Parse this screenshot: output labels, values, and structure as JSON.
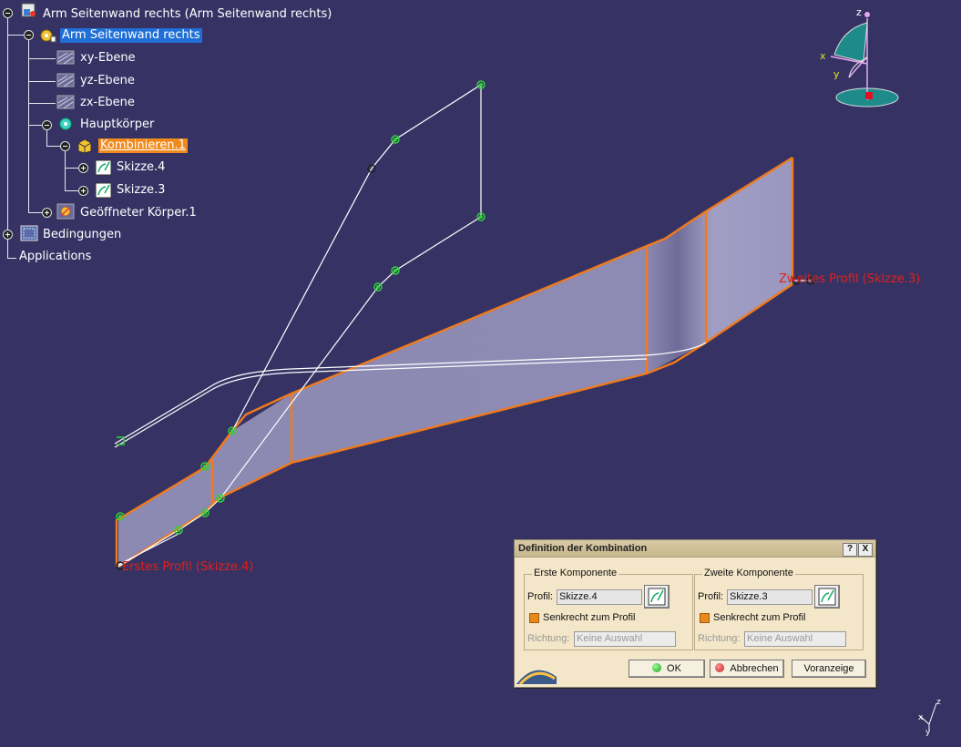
{
  "tree": {
    "root": "Arm Seitenwand rechts (Arm Seitenwand rechts)",
    "part": "Arm Seitenwand rechts",
    "xy": "xy-Ebene",
    "yz": "yz-Ebene",
    "zx": "zx-Ebene",
    "body": "Hauptkörper",
    "combine": "Kombinieren.1",
    "sketch4": "Skizze.4",
    "sketch3": "Skizze.3",
    "openbody": "Geöffneter Körper.1",
    "constraints": "Bedingungen",
    "applications": "Applications"
  },
  "viewport": {
    "second_profile_label": "Zweites Profil (Skizze.3)",
    "first_profile_label": "Erstes Profil (Skizze.4)",
    "compass_z": "z",
    "compass_x": "x",
    "compass_y": "y",
    "axis_z": "z",
    "axis_x": "x",
    "axis_y": "y",
    "colors": {
      "edge": "#f07a1c",
      "surface": "#9390b8",
      "wire": "#ffffff",
      "point": "#2fd13a",
      "background": "#363364"
    }
  },
  "dialog": {
    "title": "Definition der Kombination",
    "help": "?",
    "close": "X",
    "first": {
      "group": "Erste Komponente",
      "profile_label": "Profil:",
      "profile_value": "Skizze.4",
      "perpendicular": "Senkrecht zum Profil",
      "direction_label": "Richtung:",
      "direction_value": "Keine Auswahl"
    },
    "second": {
      "group": "Zweite Komponente",
      "profile_label": "Profil:",
      "profile_value": "Skizze.3",
      "perpendicular": "Senkrecht zum Profil",
      "direction_label": "Richtung:",
      "direction_value": "Keine Auswahl"
    },
    "ok": "OK",
    "cancel": "Abbrechen",
    "preview": "Voranzeige"
  }
}
